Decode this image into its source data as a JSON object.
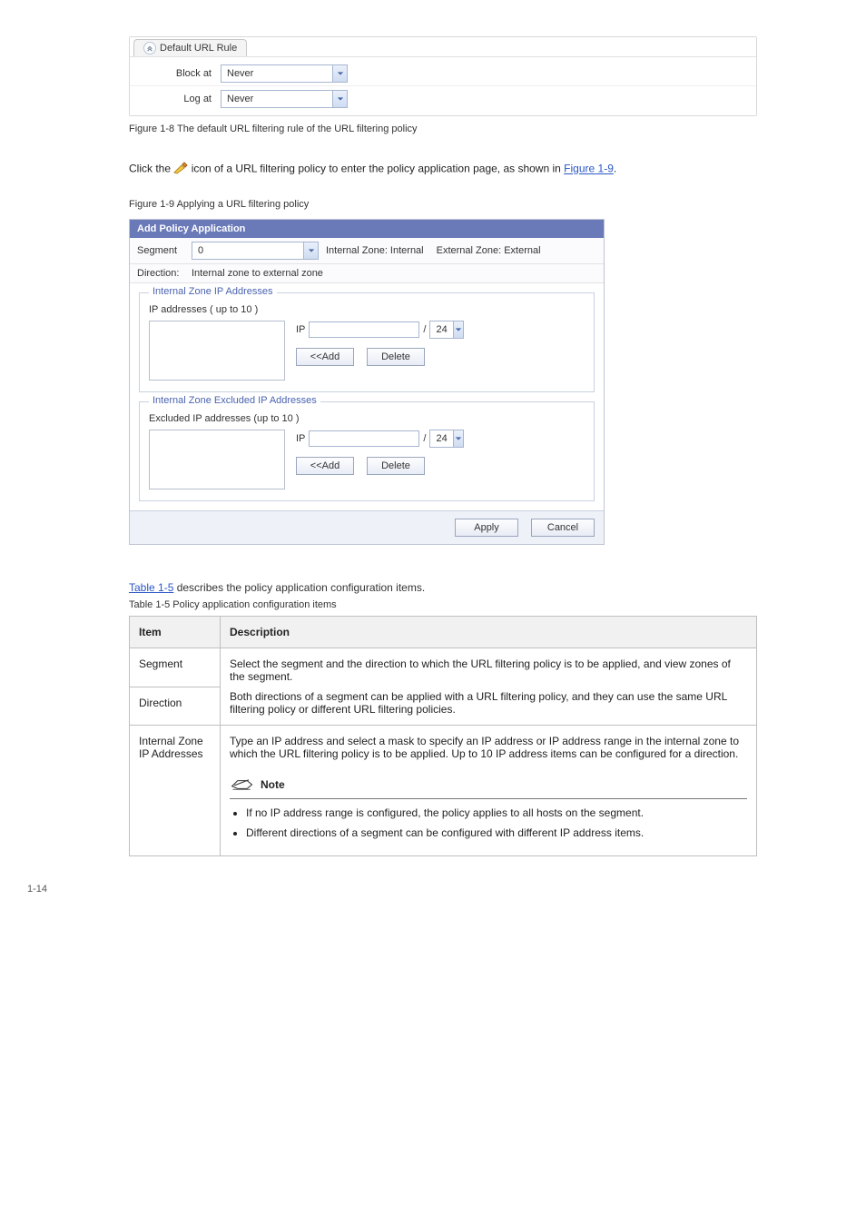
{
  "rule": {
    "title": "Default URL Rule",
    "rows": [
      {
        "label": "Block at",
        "value": "Never"
      },
      {
        "label": "Log at",
        "value": "Never"
      }
    ]
  },
  "fig1_8": "Figure 1-8 The default URL filtering rule of the URL filtering policy",
  "step_text_a": "Click the ",
  "step_text_b": " icon of a URL filtering policy to enter the policy application page, as shown in ",
  "fig1_9_link": "Figure 1-9",
  "fig1_9_caption": "Figure 1-9 Applying a URL filtering policy",
  "app": {
    "title": "Add Policy Application",
    "segment_label": "Segment",
    "segment_value": "0",
    "internal_zone_label": "Internal Zone: Internal",
    "external_zone_label": "External Zone: External",
    "direction_label": "Direction:",
    "direction_value": "Internal zone to external zone",
    "fs1": {
      "legend": "Internal Zone IP Addresses",
      "listlabel": "IP addresses ( up to 10 )",
      "ip_label": "IP",
      "mask": "24",
      "add": "<<Add",
      "delete": "Delete"
    },
    "fs2": {
      "legend": "Internal Zone Excluded IP Addresses",
      "listlabel": "Excluded IP addresses (up to 10 )",
      "ip_label": "IP",
      "mask": "24",
      "add": "<<Add",
      "delete": "Delete"
    },
    "apply": "Apply",
    "cancel": "Cancel"
  },
  "table_link": "Table 1-5",
  "para_intro_tail": " describes the policy application configuration items.",
  "table_caption": "Table 1-5 Policy application configuration items",
  "table": {
    "headers": [
      "Item",
      "Description"
    ],
    "rows": [
      {
        "c0": "Segment",
        "c1_a": "Select the segment and the direction to which the URL filtering policy is to be applied, and view zones of the segment.",
        "c1_b": "Both directions of a segment can be applied with a URL filtering policy, and they can use the same URL filtering policy or different URL filtering policies."
      },
      {
        "c0": "Direction",
        "c1": ""
      },
      {
        "c0": "Internal Zone IP Addresses",
        "c1_top": "Type an IP address and select a mask to specify an IP address or IP address range in the internal zone to which the URL filtering policy is to be applied. Up to 10 IP address items can be configured for a direction.",
        "note_word": "Note",
        "note1": "If no IP address range is configured, the policy applies to all hosts on the segment.",
        "note2": "Different directions of a segment can be configured with different IP address items."
      }
    ]
  },
  "page_num": "1-14"
}
